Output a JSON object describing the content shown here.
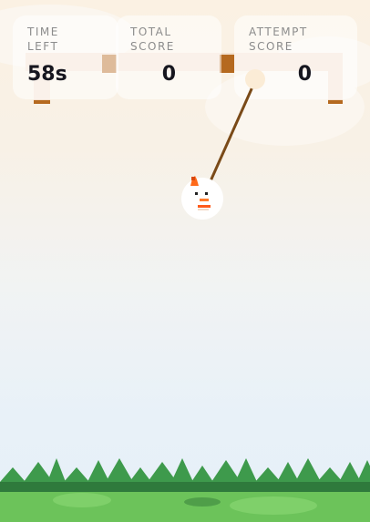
{
  "hud": {
    "time_left": {
      "label": "TIME\nLEFT",
      "value": "58s"
    },
    "total_score": {
      "label": "TOTAL\nSCORE",
      "value": "0"
    },
    "attempt_score": {
      "label": "ATTEMPT\nSCORE",
      "value": "0"
    }
  },
  "colors": {
    "sky_top": "#fbf1e3",
    "sky_bottom": "#e6f0f8",
    "beam_light": "#f3e1d0",
    "beam_dark": "#b5691f",
    "rope": "#7a4a18",
    "anchor": "#fbecd6",
    "character_flame": "#ff6a1a",
    "grass_light": "#6cc35a",
    "grass_dark": "#2f7a3c",
    "trees": "#3e9a4c"
  },
  "icons": {
    "character": "snowball-character-icon",
    "anchor": "rope-anchor-icon"
  }
}
